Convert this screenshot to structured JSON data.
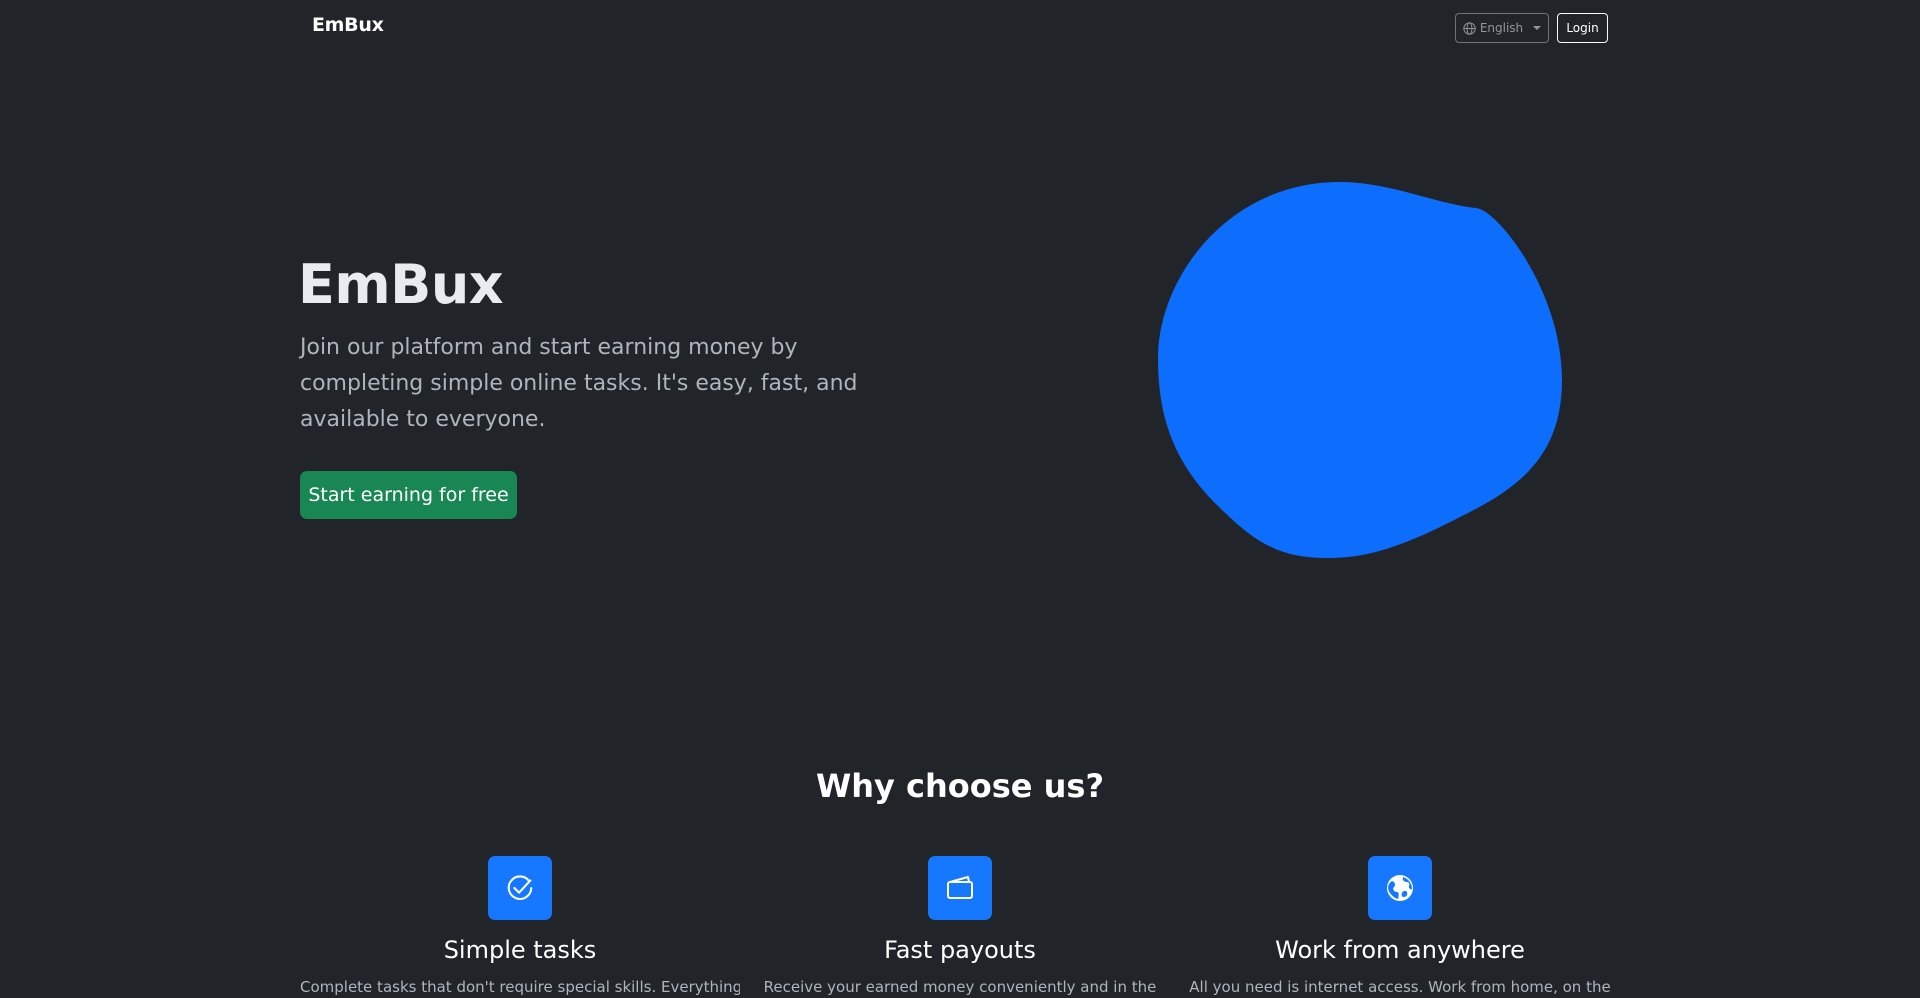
{
  "nav": {
    "brand": "EmBux",
    "language": "English",
    "login": "Login"
  },
  "hero": {
    "title": "EmBux",
    "text": "Join our platform and start earning money by completing simple online tasks. It's easy, fast, and available to everyone.",
    "cta": "Start earning for free"
  },
  "features": {
    "title": "Why choose us?",
    "items": [
      {
        "icon": "check-circle-icon",
        "title": "Simple tasks",
        "text": "Complete tasks that don't require special skills. Everything"
      },
      {
        "icon": "wallet-icon",
        "title": "Fast payouts",
        "text": "Receive your earned money conveniently and in the"
      },
      {
        "icon": "globe-icon",
        "title": "Work from anywhere",
        "text": "All you need is internet access. Work from home, on the"
      }
    ]
  },
  "colors": {
    "background": "#212529",
    "primary": "#0d6efd",
    "success": "#198754"
  }
}
